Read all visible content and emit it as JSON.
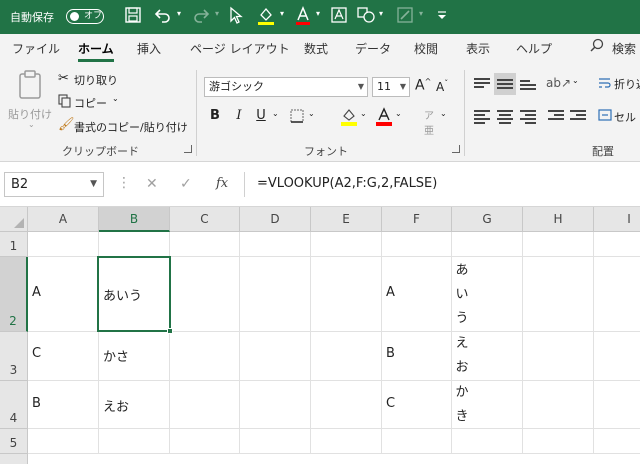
{
  "titlebar": {
    "autosave_label": "自動保存",
    "autosave_state": "オフ",
    "icons": [
      "save-icon",
      "undo-icon",
      "redo-icon",
      "cursor-icon",
      "fill-color-icon",
      "font-color-icon",
      "text-box-icon",
      "shapes-icon",
      "pen-icon",
      "customize-icon"
    ]
  },
  "tabs": [
    {
      "label": "ファイル"
    },
    {
      "label": "ホーム",
      "active": true
    },
    {
      "label": "挿入"
    },
    {
      "label": "ページ レイアウト"
    },
    {
      "label": "数式"
    },
    {
      "label": "データ"
    },
    {
      "label": "校閲"
    },
    {
      "label": "表示"
    },
    {
      "label": "ヘルプ"
    },
    {
      "label": "検索"
    }
  ],
  "ribbon": {
    "clipboard": {
      "paste_label": "貼り付け",
      "cut_label": "切り取り",
      "copy_label": "コピー",
      "format_painter_label": "書式のコピー/貼り付け",
      "group_label": "クリップボード"
    },
    "font": {
      "font_name": "游ゴシック",
      "font_size": "11",
      "bold": "B",
      "italic": "I",
      "underline": "U",
      "grow": "A",
      "shrink": "A",
      "group_label": "フォント"
    },
    "alignment": {
      "wrap_label": "折り返",
      "merge_label": "セル",
      "group_label": "配置"
    },
    "colors": {
      "accent": "#217346",
      "highlight": "#ffff00",
      "font_color": "#ff0000"
    }
  },
  "formula_bar": {
    "name_box": "B2",
    "formula": "=VLOOKUP(A2,F:G,2,FALSE)",
    "fx": "fx"
  },
  "sheet": {
    "columns": [
      "A",
      "B",
      "C",
      "D",
      "E",
      "F",
      "G",
      "H",
      "I"
    ],
    "rows": [
      "1",
      "2",
      "3",
      "4",
      "5"
    ],
    "selected_cell": "B2",
    "cells": {
      "A2": "A",
      "B2": "あいう",
      "F2": "A",
      "A3": "C",
      "B3": "かさ",
      "F3": "B",
      "A4": "B",
      "B4": "えお",
      "F4": "C"
    },
    "g_column_chars": [
      "あ",
      "い",
      "う",
      "え",
      "お",
      "か",
      "き"
    ]
  }
}
